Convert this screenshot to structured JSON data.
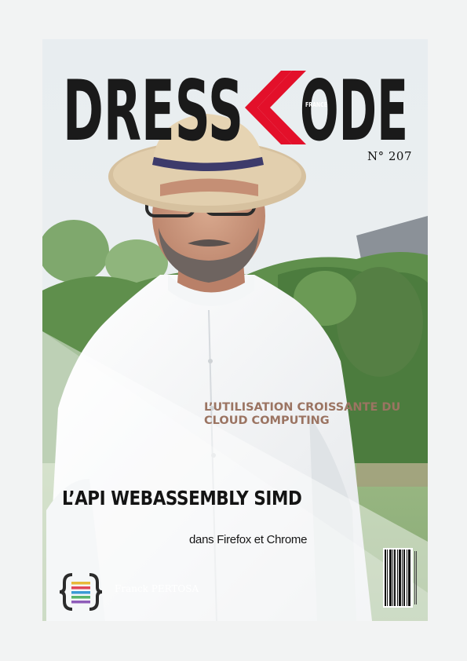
{
  "magazine": {
    "title_part1": "DRESS",
    "title_part2": "ODE",
    "title_tag": "FRANCE",
    "issue": "N° 207"
  },
  "cover_lines": {
    "cloud": "L’UTILISATION CROISSANTE DU CLOUD COMPUTING",
    "headline": "L’API WEBASSEMBLY SIMD",
    "subheadline": "dans Firefox et Chrome"
  },
  "author": {
    "name": "Franck PERTOSA",
    "logo_icon": "code-braces-icon"
  },
  "barcode": {
    "icon": "barcode-icon"
  },
  "colors": {
    "masthead": "#1a1a1a",
    "accent": "#e3102a",
    "cloud_text": "#9b7462",
    "page_bg": "#f2f3f3"
  }
}
